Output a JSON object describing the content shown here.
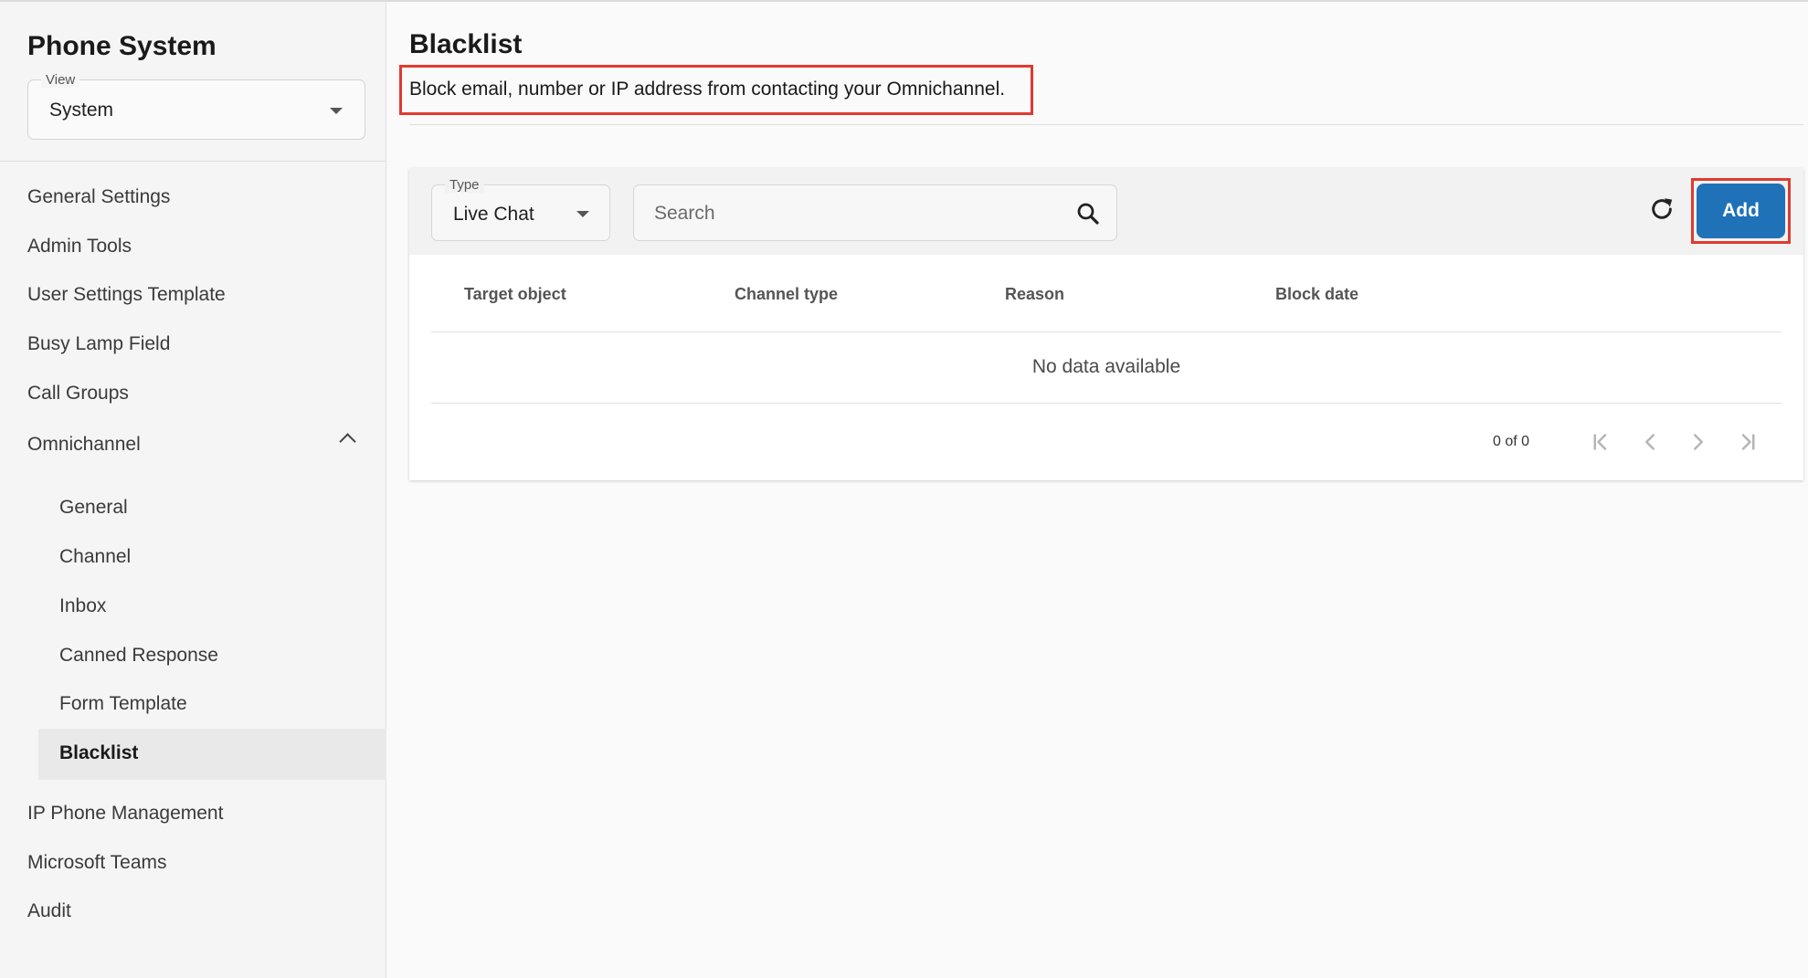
{
  "sidebar": {
    "title": "Phone System",
    "view_select": {
      "legend": "View",
      "value": "System"
    },
    "items": [
      {
        "label": "General Settings"
      },
      {
        "label": "Admin Tools"
      },
      {
        "label": "User Settings Template"
      },
      {
        "label": "Busy Lamp Field"
      },
      {
        "label": "Call Groups"
      },
      {
        "label": "Omnichannel",
        "expanded": true
      },
      {
        "label": "IP Phone Management"
      },
      {
        "label": "Microsoft Teams"
      },
      {
        "label": "Audit"
      }
    ],
    "omnichannel_children": [
      {
        "label": "General"
      },
      {
        "label": "Channel"
      },
      {
        "label": "Inbox"
      },
      {
        "label": "Canned Response"
      },
      {
        "label": "Form Template"
      },
      {
        "label": "Blacklist",
        "active": true
      }
    ]
  },
  "main": {
    "title": "Blacklist",
    "description": "Block email, number or IP address from contacting your Omnichannel.",
    "toolbar": {
      "type_select": {
        "legend": "Type",
        "value": "Live Chat"
      },
      "search": {
        "placeholder": "Search",
        "value": ""
      },
      "add_label": "Add"
    },
    "table": {
      "columns": [
        "Target object",
        "Channel type",
        "Reason",
        "Block date"
      ],
      "rows": [],
      "empty_message": "No data available"
    },
    "pagination": {
      "range_text": "0 of 0"
    }
  },
  "colors": {
    "accent": "#1f72b8",
    "highlight": "#e03a2f",
    "sidebar_bg": "#f5f5f5",
    "active_item_bg": "#e9e9e9"
  },
  "icons": {
    "view_dropdown": "caret-down-icon",
    "omnichannel_toggle": "chevron-up-icon",
    "type_dropdown": "caret-down-icon",
    "search": "search-icon",
    "refresh": "refresh-icon",
    "pagination": [
      "first-page-icon",
      "prev-page-icon",
      "next-page-icon",
      "last-page-icon"
    ]
  }
}
